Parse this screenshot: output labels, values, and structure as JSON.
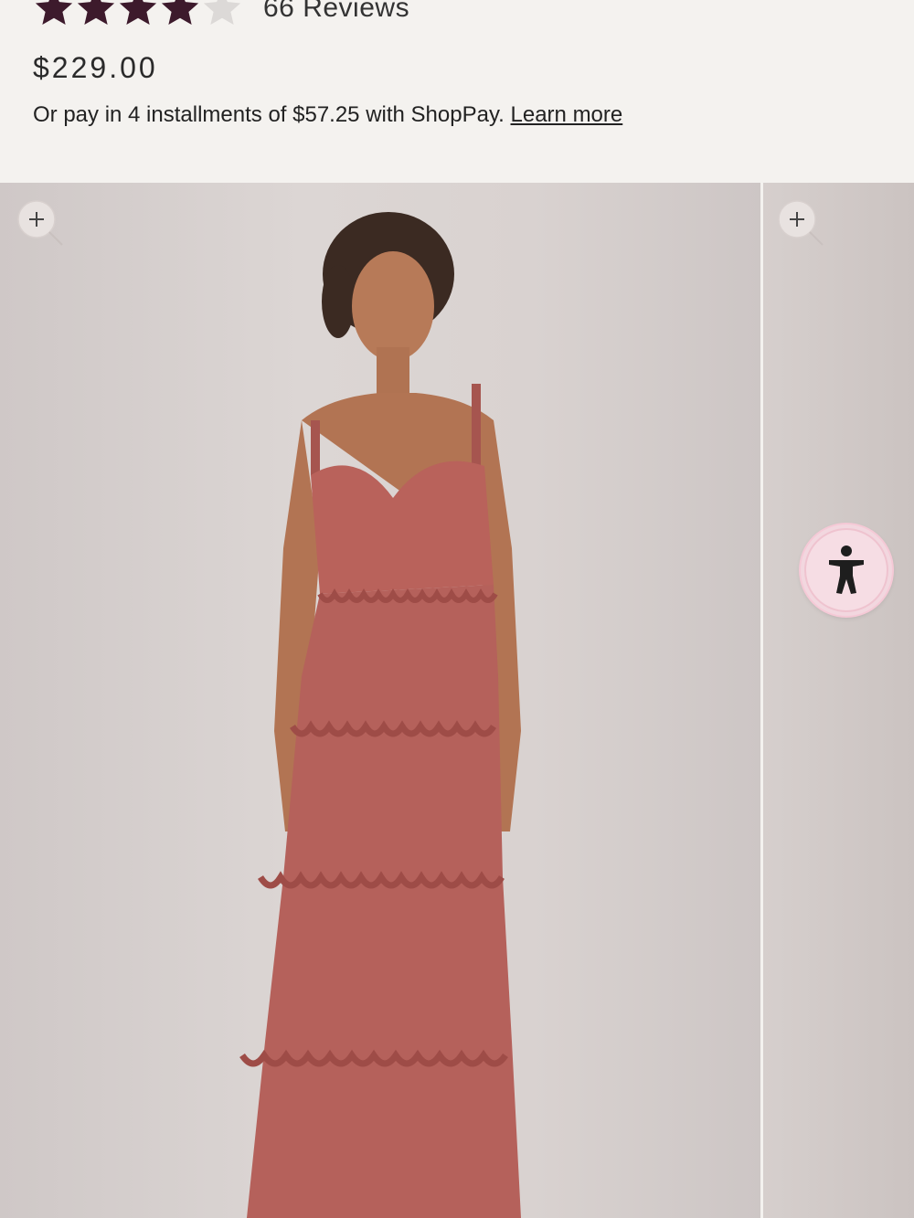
{
  "product": {
    "rating": 4,
    "rating_max": 5,
    "reviews_label": "66 Reviews",
    "price": "$229.00",
    "installments_text": "Or pay in 4 installments of $57.25 with ShopPay.",
    "learn_more_label": "Learn more"
  },
  "gallery": {
    "image_alt": "Model wearing rust pink tiered ruffle maxi dress"
  },
  "colors": {
    "star_filled": "#3d1a2c",
    "star_empty": "#d9d6d4",
    "dress": "#b5615b",
    "accessibility_bg": "#f2d7df"
  },
  "icons": {
    "zoom": "zoom-in-icon",
    "accessibility": "accessibility-icon"
  }
}
